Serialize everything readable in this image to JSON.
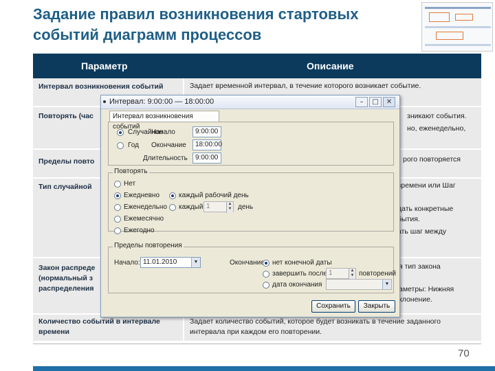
{
  "slide": {
    "title_line1": "Задание правил возникновения стартовых",
    "title_line2": "событий диаграмм процессов",
    "page_number": "70"
  },
  "table": {
    "headers": [
      "Параметр",
      "Описание"
    ],
    "rows": [
      {
        "param": [
          "Интервал возникновения событий"
        ],
        "desc": [
          "Задает временной интервал, в течение которого возникает событие."
        ]
      },
      {
        "param": [
          "Повторять (час"
        ],
        "desc": [
          "зникают события.",
          "но, еженедельно,"
        ]
      },
      {
        "param": [
          "Пределы повто"
        ],
        "desc": [
          "рого повторяется"
        ]
      },
      {
        "param": [
          "Тип случайной"
        ],
        "desc": [
          "т времени или Шаг",
          "",
          "дать конкретные",
          "бытия.",
          "ать шаг между"
        ]
      },
      {
        "param": [
          "Закон распреде",
          "(нормальный з",
          "распределения"
        ],
        "desc": [
          "я тип закона",
          "",
          "аметры: Нижняя",
          "клонение."
        ]
      },
      {
        "param": [
          "Количество событий в интервале",
          "времени"
        ],
        "desc": [
          "Задает количество событий, которое будет возникать в течение заданного",
          "интервала при каждом его повторении."
        ]
      }
    ]
  },
  "dialog": {
    "title": "Интервал: 9:00:00 — 18:00:00",
    "tab_label": "Интервал возникновения событий",
    "interval": {
      "radio1": "Случайное",
      "radio2": "Год",
      "start_label": "Начало",
      "end_label": "Окончание",
      "duration_label": "Длительность",
      "start_value": "9:00:00",
      "end_value": "18:00:00",
      "duration_value": "9:00:00"
    },
    "repeat": {
      "group_label": "Повторять",
      "options": [
        "Нет",
        "Ежедневно",
        "Еженедельно",
        "Ежемесячно",
        "Ежегодно"
      ],
      "every_workday": "каждый рабочий день",
      "every_label": "каждый",
      "every_value": "1",
      "day_label": "день"
    },
    "limits": {
      "group_label": "Пределы повторения",
      "start_label": "Начало:",
      "start_value": "11.01.2010",
      "end_group_label": "Окончание:",
      "end_options": [
        "нет конечной даты",
        "завершить после",
        "дата окончания"
      ],
      "count_value": "1",
      "count_label": "повторений"
    },
    "save_label": "Сохранить",
    "close_label": "Закрыть"
  }
}
